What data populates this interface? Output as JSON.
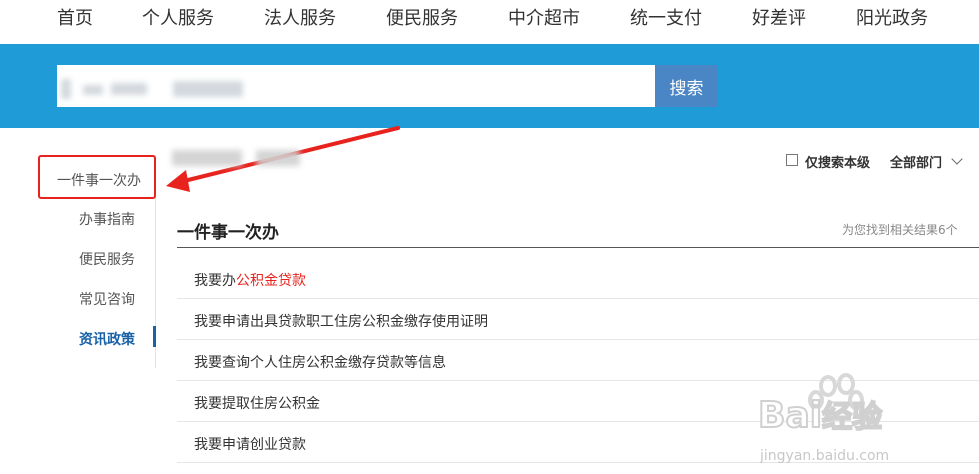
{
  "topnav": {
    "items": [
      "首页",
      "个人服务",
      "法人服务",
      "便民服务",
      "中介超市",
      "统一支付",
      "好差评",
      "阳光政务"
    ]
  },
  "search": {
    "button_label": "搜索",
    "value": ""
  },
  "sidebar": {
    "items": [
      {
        "label": "一件事一次办",
        "active": false
      },
      {
        "label": "办事指南",
        "active": false
      },
      {
        "label": "便民服务",
        "active": false
      },
      {
        "label": "常见咨询",
        "active": false
      },
      {
        "label": "资讯政策",
        "active": true
      }
    ]
  },
  "filters": {
    "local_only_label": "仅搜索本级",
    "department_label": "全部部门"
  },
  "results": {
    "section_title": "一件事一次办",
    "count_text": "为您找到相关结果6个",
    "rows": [
      {
        "prefix": "我要办",
        "highlight": "公积金贷款"
      },
      {
        "prefix": "我要申请出具贷款职工住房公积金缴存使用证明",
        "highlight": ""
      },
      {
        "prefix": "我要查询个人住房公积金缴存贷款等信息",
        "highlight": ""
      },
      {
        "prefix": "我要提取住房公积金",
        "highlight": ""
      },
      {
        "prefix": "我要申请创业贷款",
        "highlight": ""
      }
    ]
  },
  "watermark": {
    "brand": "Bai",
    "brand_tail": "经验",
    "url": "jingyan.baidu.com"
  },
  "colors": {
    "banner": "#1f9bd8",
    "search_button": "#4a86c5",
    "active_link": "#1a62a8",
    "highlight_red": "#e8231e"
  }
}
